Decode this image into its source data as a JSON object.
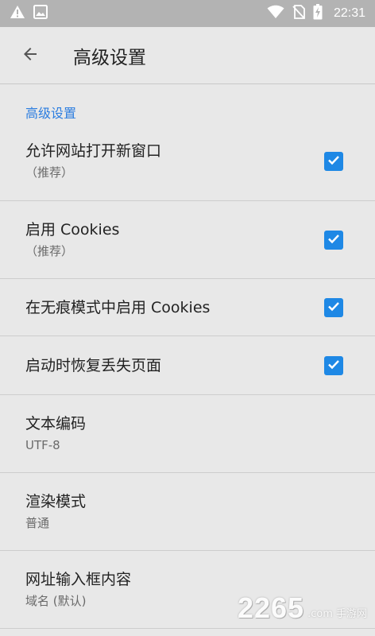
{
  "status_bar": {
    "time": "22:31",
    "icons_left": [
      "warning-icon",
      "image-icon"
    ],
    "icons_right": [
      "wifi-icon",
      "no-sim-icon",
      "battery-charging-icon"
    ]
  },
  "app_bar": {
    "title": "高级设置",
    "back_icon": "arrow-back-icon"
  },
  "section": {
    "title": "高级设置"
  },
  "settings": [
    {
      "title": "允许网站打开新窗口",
      "subtitle": "（推荐）",
      "checked": true
    },
    {
      "title": "启用 Cookies",
      "subtitle": "（推荐）",
      "checked": true
    },
    {
      "title": "在无痕模式中启用 Cookies",
      "checked": true
    },
    {
      "title": "启动时恢复丢失页面",
      "checked": true
    },
    {
      "title": "文本编码",
      "subtitle": "UTF-8"
    },
    {
      "title": "渲染模式",
      "subtitle": "普通"
    },
    {
      "title": "网址输入框内容",
      "subtitle": "域名 (默认)"
    }
  ],
  "watermark": {
    "brand": "2265",
    "suffix": ".com",
    "tag": "手游网"
  },
  "colors": {
    "accent": "#2b7de0",
    "checkbox": "#1e88e5",
    "status_bar": "#b3b3b3",
    "background": "#e8e8e8"
  }
}
